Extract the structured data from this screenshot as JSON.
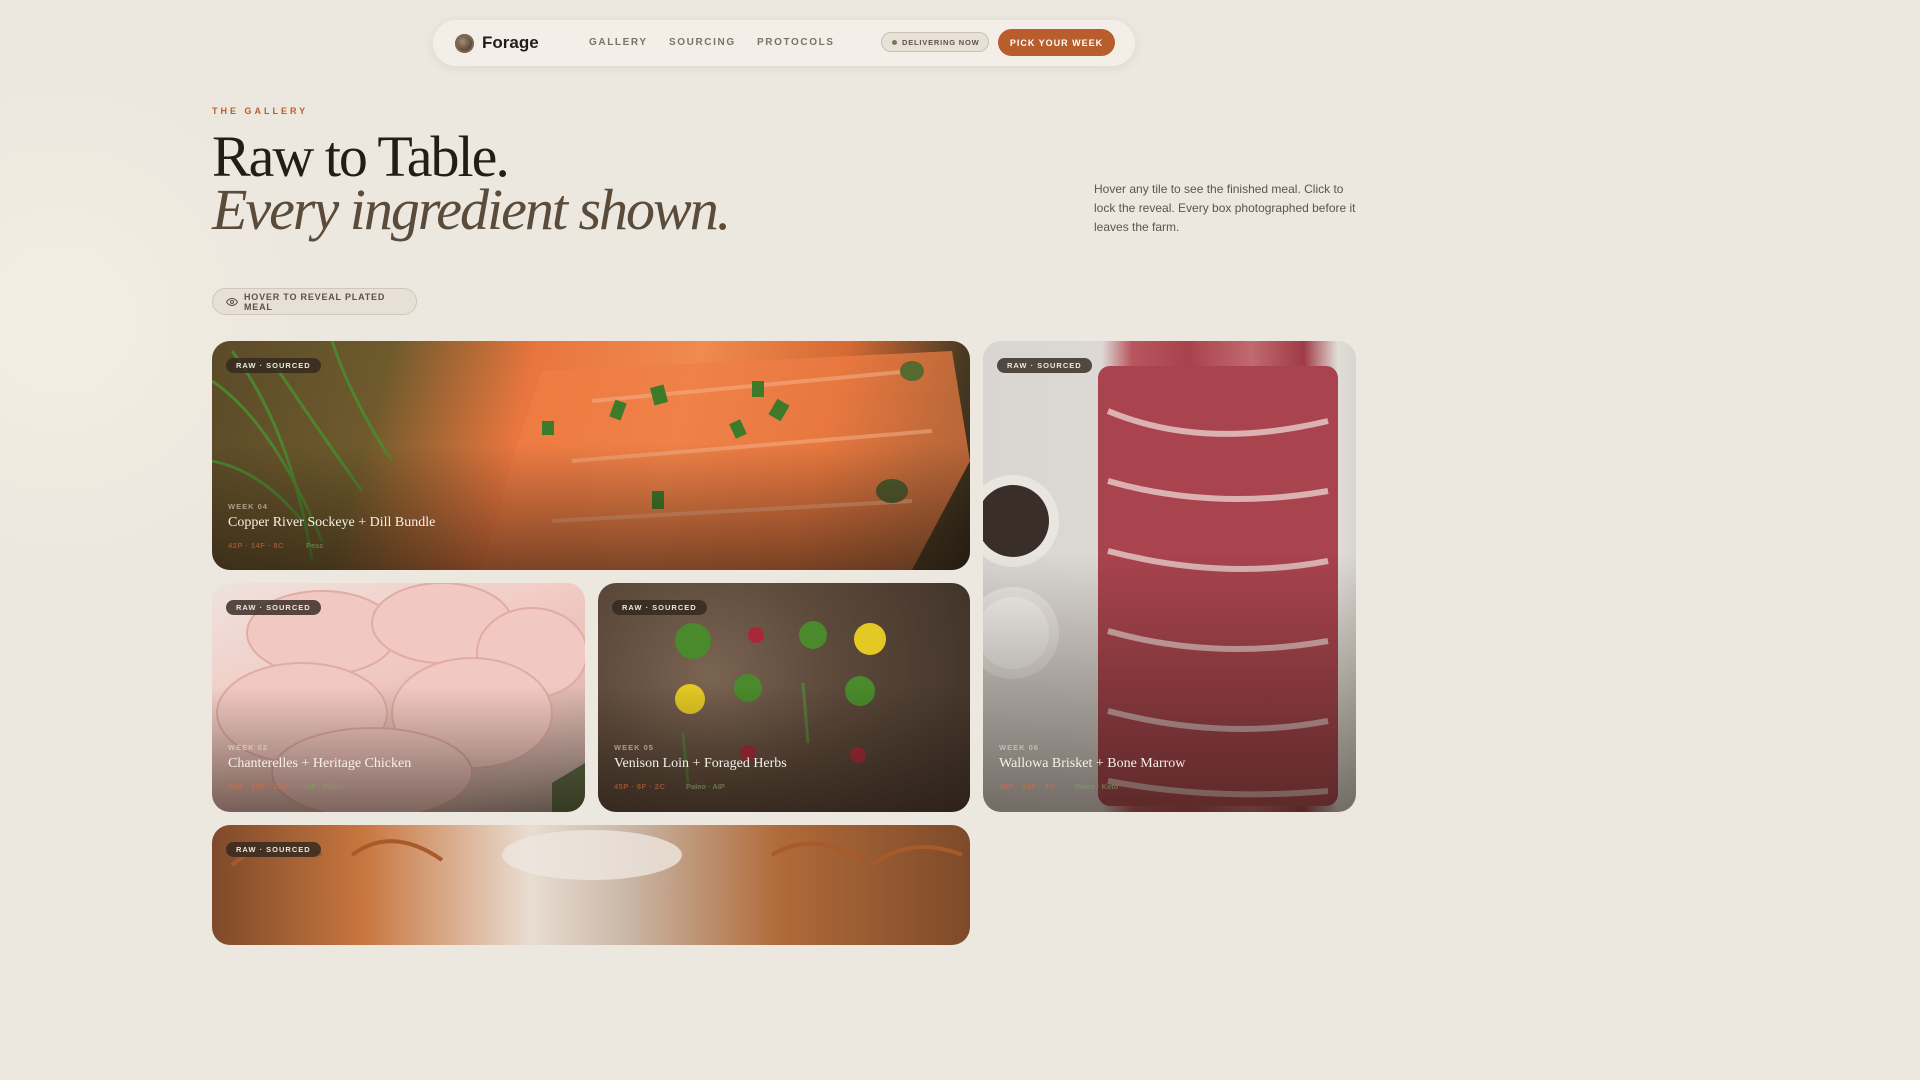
{
  "nav": {
    "brand": "Forage",
    "links": [
      "GALLERY",
      "SOURCING",
      "PROTOCOLS"
    ],
    "status": "DELIVERING NOW",
    "cta": "PICK YOUR WEEK"
  },
  "hero": {
    "eyebrow": "THE GALLERY",
    "title_line1": "Raw to Table.",
    "title_line2": "Every ingredient shown.",
    "intro": "Hover any tile to see the finished meal. Click to lock the reveal. Every box photographed before it leaves the farm."
  },
  "hint": "HOVER TO REVEAL PLATED MEAL",
  "tiles": [
    {
      "badge": "RAW · SOURCED",
      "week": "WEEK 04",
      "title": "Copper River Sockeye + Dill Bundle",
      "macros": "42P · 14F · 8C",
      "tag": "Pesc"
    },
    {
      "badge": "RAW · SOURCED",
      "week": "WEEK 06",
      "title": "Wallowa Brisket + Bone Marrow",
      "macros": "48P · 32F · 4C",
      "tag": "Paleo · Keto"
    },
    {
      "badge": "RAW · SOURCED",
      "week": "WEEK 02",
      "title": "Chanterelles + Heritage Chicken",
      "macros": "38P · 16F · 12C",
      "tag": "AIP · Paleo"
    },
    {
      "badge": "RAW · SOURCED",
      "week": "WEEK 05",
      "title": "Venison Loin + Foraged Herbs",
      "macros": "45P · 8F · 2C",
      "tag": "Paleo · AIP"
    },
    {
      "badge": "RAW · SOURCED"
    }
  ]
}
